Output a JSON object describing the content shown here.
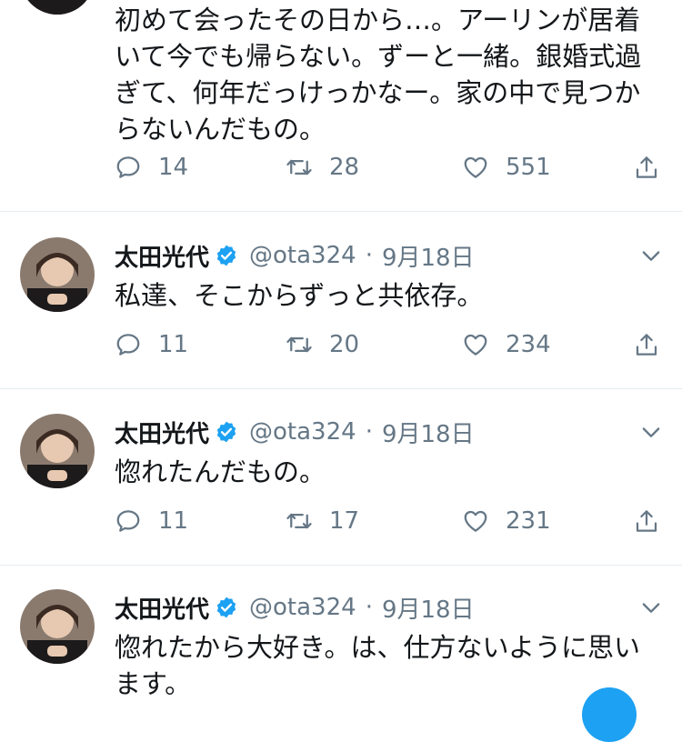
{
  "tweets": [
    {
      "text": "初めて会ったその日から…。アーリンが居着いて今でも帰らない。ずーと一緒。銀婚式過ぎて、何年だっけっかなー。家の中で見つからないんだもの。",
      "reply_count": "14",
      "retweet_count": "28",
      "like_count": "551"
    },
    {
      "name": "太田光代",
      "handle": "@ota324",
      "separator": "·",
      "date": "9月18日",
      "text": "私達、そこからずっと共依存。",
      "reply_count": "11",
      "retweet_count": "20",
      "like_count": "234"
    },
    {
      "name": "太田光代",
      "handle": "@ota324",
      "separator": "·",
      "date": "9月18日",
      "text": "惚れたんだもの。",
      "reply_count": "11",
      "retweet_count": "17",
      "like_count": "231"
    },
    {
      "name": "太田光代",
      "handle": "@ota324",
      "separator": "·",
      "date": "9月18日",
      "text": "惚れたから大好き。は、仕方ないように思います。"
    }
  ],
  "colors": {
    "text": "#14171a",
    "secondary": "#657786",
    "verified": "#1da1f2",
    "divider": "#e6ecf0",
    "fab": "#1da1f2"
  },
  "icons": [
    "reply-icon",
    "retweet-icon",
    "like-icon",
    "share-icon",
    "verified-badge-icon",
    "chevron-down-icon"
  ]
}
